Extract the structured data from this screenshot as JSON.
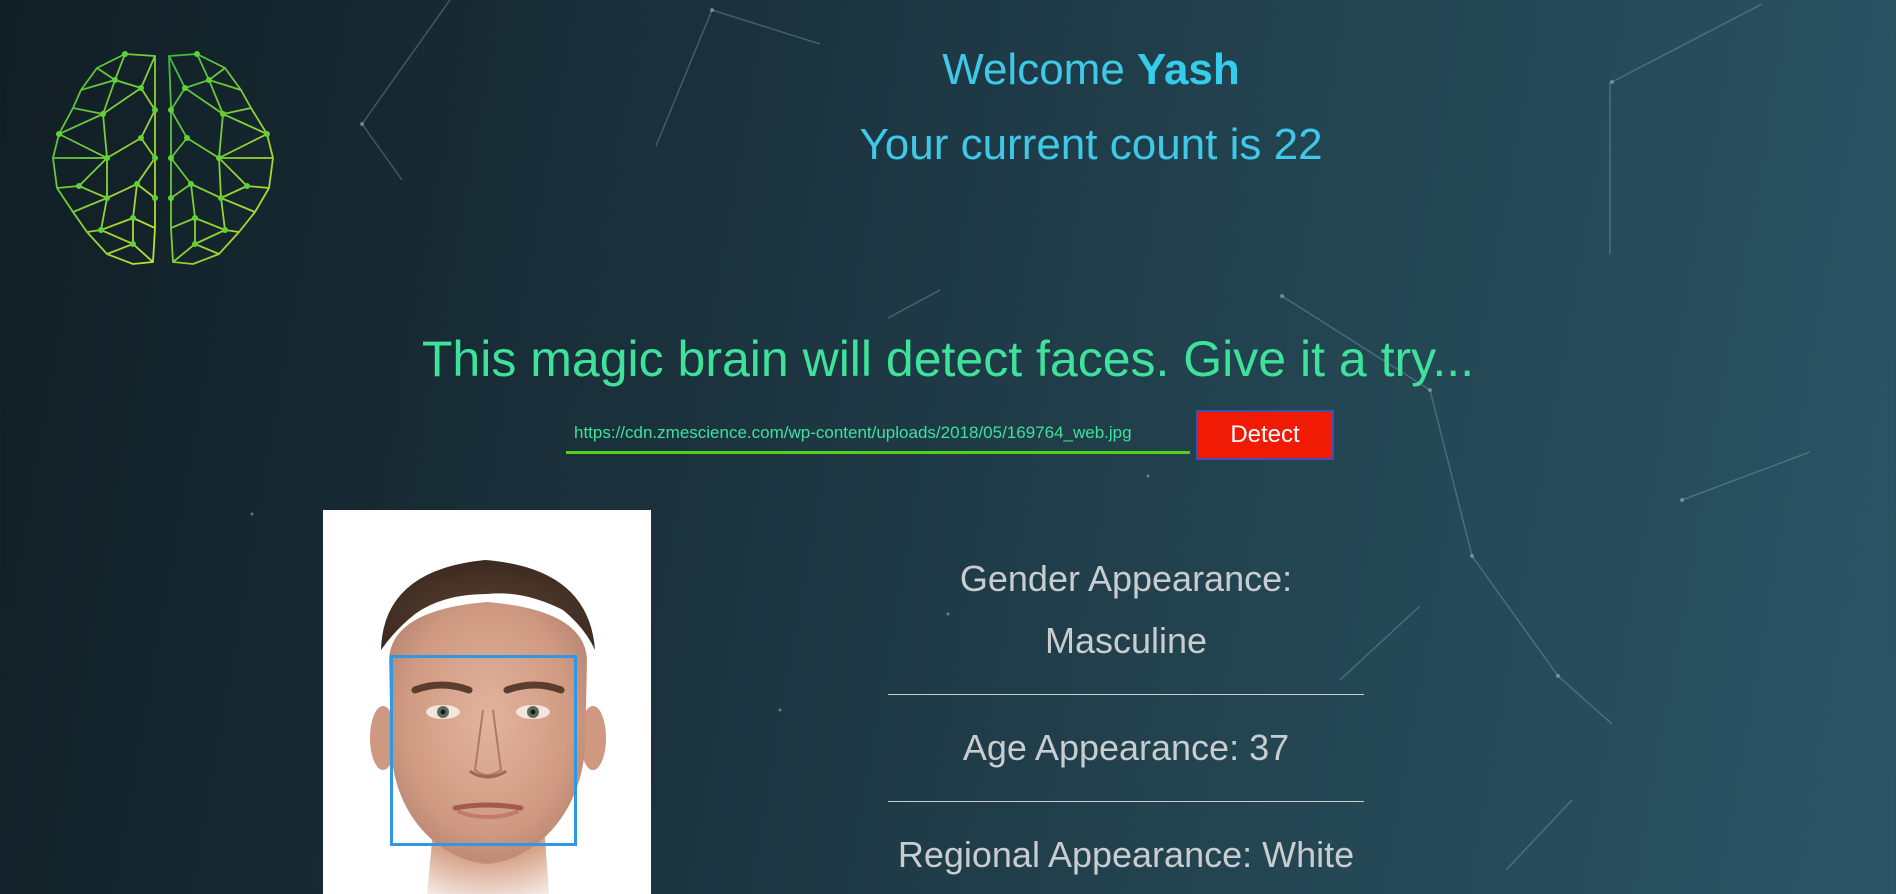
{
  "header": {
    "welcome_prefix": "Welcome",
    "user_name": "Yash",
    "count_text": "Your current count is 22"
  },
  "main": {
    "tagline": "This magic brain will detect faces. Give it a try...",
    "url_input_value": "https://cdn.zmescience.com/wp-content/uploads/2018/05/169764_web.jpg",
    "detect_label": "Detect"
  },
  "results": {
    "gender_label": "Gender Appearance:",
    "gender_value": "Masculine",
    "age_text": "Age Appearance: 37",
    "region_text": "Regional Appearance: White"
  },
  "colors": {
    "accent_blue": "#3fc9e8",
    "accent_green": "#3ee29a",
    "detect_red": "#f01a05",
    "face_box_blue": "#2f97e3"
  },
  "icons": {
    "logo": "brain-icon"
  }
}
